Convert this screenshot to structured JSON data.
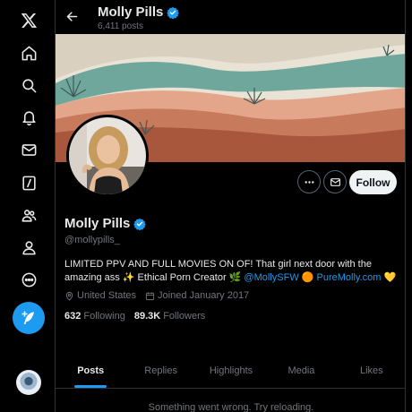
{
  "header": {
    "name": "Molly Pills",
    "post_count": "6,411 posts"
  },
  "profile": {
    "display_name": "Molly Pills",
    "handle": "@mollypills_",
    "bio_text": "LIMITED PPV AND FULL MOVIES ON OF! That girl next door with the amazing ass ✨ Ethical Porn Creator 🌿",
    "bio_link_1": "@MollySFW",
    "bio_emoji_orange": "🟠",
    "bio_link_2": "PureMolly.com",
    "bio_heart": "💛",
    "location": "United States",
    "joined": "Joined January 2017",
    "following_count": "632",
    "following_label": "Following",
    "followers_count": "89.3K",
    "followers_label": "Followers"
  },
  "actions": {
    "follow_label": "Follow"
  },
  "tabs": [
    {
      "label": "Posts",
      "active": true
    },
    {
      "label": "Replies"
    },
    {
      "label": "Highlights"
    },
    {
      "label": "Media"
    },
    {
      "label": "Likes"
    }
  ],
  "feed": {
    "error_message": "Something went wrong. Try reloading."
  },
  "nav_icons": [
    "x-logo-icon",
    "home-icon",
    "explore-icon",
    "notifications-icon",
    "messages-icon",
    "grok-icon",
    "communities-icon",
    "profile-icon",
    "more-icon",
    "post-icon"
  ],
  "colors": {
    "accent": "#1d9bf0",
    "background": "#000000",
    "muted_text": "#71767b"
  }
}
